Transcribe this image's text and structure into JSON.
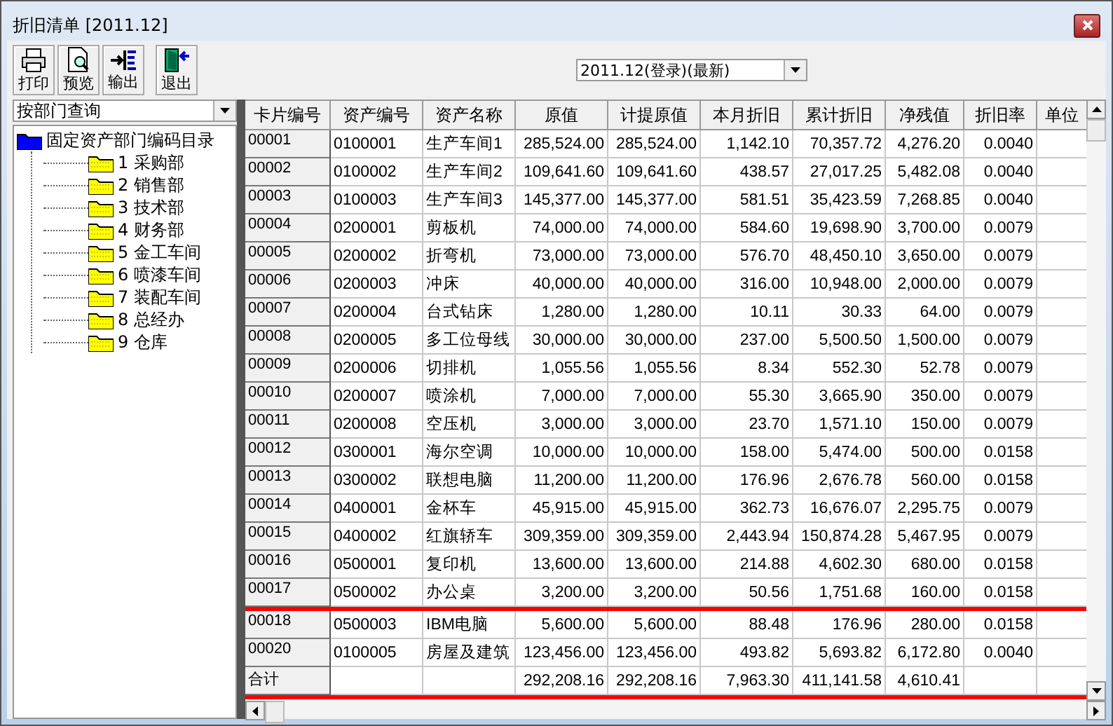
{
  "window": {
    "title": "折旧清单 [2011.12]"
  },
  "toolbar": [
    {
      "kind": "print",
      "label": "打印"
    },
    {
      "kind": "preview",
      "label": "预览"
    },
    {
      "kind": "export",
      "label": "输出"
    },
    {
      "kind": "exit",
      "label": "退出"
    }
  ],
  "period": {
    "value": "2011.12(登录)(最新)"
  },
  "query": {
    "value": "按部门查询"
  },
  "tree": {
    "label": "固定资产部门编码目录",
    "expanded": true,
    "children": [
      {
        "label": "1 采购部"
      },
      {
        "label": "2 销售部"
      },
      {
        "label": "3 技术部"
      },
      {
        "label": "4 财务部"
      },
      {
        "label": "5 金工车间"
      },
      {
        "label": "6 喷漆车间"
      },
      {
        "label": "7 装配车间"
      },
      {
        "label": "8 总经办"
      },
      {
        "label": "9 仓库"
      }
    ]
  },
  "table": {
    "columns": [
      "卡片编号",
      "资产编号",
      "资产名称",
      "原值",
      "计提原值",
      "本月折旧",
      "累计折旧",
      "净残值",
      "折旧率",
      "单位"
    ],
    "rows": [
      {
        "card": "00001",
        "asset_no": "0100001",
        "name": "生产车间1",
        "original": "285,524.00",
        "provision": "285,524.00",
        "monthly": "1,142.10",
        "accumulated": "70,357.72",
        "residual": "4,276.20",
        "rate": "0.0040",
        "highlighted": false
      },
      {
        "card": "00002",
        "asset_no": "0100002",
        "name": "生产车间2",
        "original": "109,641.60",
        "provision": "109,641.60",
        "monthly": "438.57",
        "accumulated": "27,017.25",
        "residual": "5,482.08",
        "rate": "0.0040",
        "highlighted": false
      },
      {
        "card": "00003",
        "asset_no": "0100003",
        "name": "生产车间3",
        "original": "145,377.00",
        "provision": "145,377.00",
        "monthly": "581.51",
        "accumulated": "35,423.59",
        "residual": "7,268.85",
        "rate": "0.0040",
        "highlighted": false
      },
      {
        "card": "00004",
        "asset_no": "0200001",
        "name": "剪板机",
        "original": "74,000.00",
        "provision": "74,000.00",
        "monthly": "584.60",
        "accumulated": "19,698.90",
        "residual": "3,700.00",
        "rate": "0.0079",
        "highlighted": false
      },
      {
        "card": "00005",
        "asset_no": "0200002",
        "name": "折弯机",
        "original": "73,000.00",
        "provision": "73,000.00",
        "monthly": "576.70",
        "accumulated": "48,450.10",
        "residual": "3,650.00",
        "rate": "0.0079",
        "highlighted": false
      },
      {
        "card": "00006",
        "asset_no": "0200003",
        "name": "冲床",
        "original": "40,000.00",
        "provision": "40,000.00",
        "monthly": "316.00",
        "accumulated": "10,948.00",
        "residual": "2,000.00",
        "rate": "0.0079",
        "highlighted": false
      },
      {
        "card": "00007",
        "asset_no": "0200004",
        "name": "台式钻床",
        "original": "1,280.00",
        "provision": "1,280.00",
        "monthly": "10.11",
        "accumulated": "30.33",
        "residual": "64.00",
        "rate": "0.0079",
        "highlighted": false
      },
      {
        "card": "00008",
        "asset_no": "0200005",
        "name": "多工位母线",
        "original": "30,000.00",
        "provision": "30,000.00",
        "monthly": "237.00",
        "accumulated": "5,500.50",
        "residual": "1,500.00",
        "rate": "0.0079",
        "highlighted": false
      },
      {
        "card": "00009",
        "asset_no": "0200006",
        "name": "切排机",
        "original": "1,055.56",
        "provision": "1,055.56",
        "monthly": "8.34",
        "accumulated": "552.30",
        "residual": "52.78",
        "rate": "0.0079",
        "highlighted": false
      },
      {
        "card": "00010",
        "asset_no": "0200007",
        "name": "喷涂机",
        "original": "7,000.00",
        "provision": "7,000.00",
        "monthly": "55.30",
        "accumulated": "3,665.90",
        "residual": "350.00",
        "rate": "0.0079",
        "highlighted": false
      },
      {
        "card": "00011",
        "asset_no": "0200008",
        "name": "空压机",
        "original": "3,000.00",
        "provision": "3,000.00",
        "monthly": "23.70",
        "accumulated": "1,571.10",
        "residual": "150.00",
        "rate": "0.0079",
        "highlighted": false
      },
      {
        "card": "00012",
        "asset_no": "0300001",
        "name": "海尔空调",
        "original": "10,000.00",
        "provision": "10,000.00",
        "monthly": "158.00",
        "accumulated": "5,474.00",
        "residual": "500.00",
        "rate": "0.0158",
        "highlighted": false
      },
      {
        "card": "00013",
        "asset_no": "0300002",
        "name": "联想电脑",
        "original": "11,200.00",
        "provision": "11,200.00",
        "monthly": "176.96",
        "accumulated": "2,676.78",
        "residual": "560.00",
        "rate": "0.0158",
        "highlighted": false
      },
      {
        "card": "00014",
        "asset_no": "0400001",
        "name": "金杯车",
        "original": "45,915.00",
        "provision": "45,915.00",
        "monthly": "362.73",
        "accumulated": "16,676.07",
        "residual": "2,295.75",
        "rate": "0.0079",
        "highlighted": false
      },
      {
        "card": "00015",
        "asset_no": "0400002",
        "name": "红旗轿车",
        "original": "309,359.00",
        "provision": "309,359.00",
        "monthly": "2,443.94",
        "accumulated": "150,874.28",
        "residual": "5,467.95",
        "rate": "0.0079",
        "highlighted": false
      },
      {
        "card": "00016",
        "asset_no": "0500001",
        "name": "复印机",
        "original": "13,600.00",
        "provision": "13,600.00",
        "monthly": "214.88",
        "accumulated": "4,602.30",
        "residual": "680.00",
        "rate": "0.0158",
        "highlighted": false
      },
      {
        "card": "00017",
        "asset_no": "0500002",
        "name": "办公桌",
        "original": "3,200.00",
        "provision": "3,200.00",
        "monthly": "50.56",
        "accumulated": "1,751.68",
        "residual": "160.00",
        "rate": "0.0158",
        "highlighted": false
      },
      {
        "card": "00018",
        "asset_no": "0500003",
        "name": "IBM电脑",
        "original": "5,600.00",
        "provision": "5,600.00",
        "monthly": "88.48",
        "accumulated": "176.96",
        "residual": "280.00",
        "rate": "0.0158",
        "highlighted": true
      },
      {
        "card": "00020",
        "asset_no": "0100005",
        "name": "房屋及建筑",
        "original": "123,456.00",
        "provision": "123,456.00",
        "monthly": "493.82",
        "accumulated": "5,693.82",
        "residual": "6,172.80",
        "rate": "0.0040",
        "highlighted": true
      }
    ],
    "total": {
      "card": "合计",
      "original": "292,208.16",
      "provision": "292,208.16",
      "monthly": "7,963.30",
      "accumulated": "411,141.58",
      "residual": "4,610.41",
      "highlighted": true
    }
  }
}
